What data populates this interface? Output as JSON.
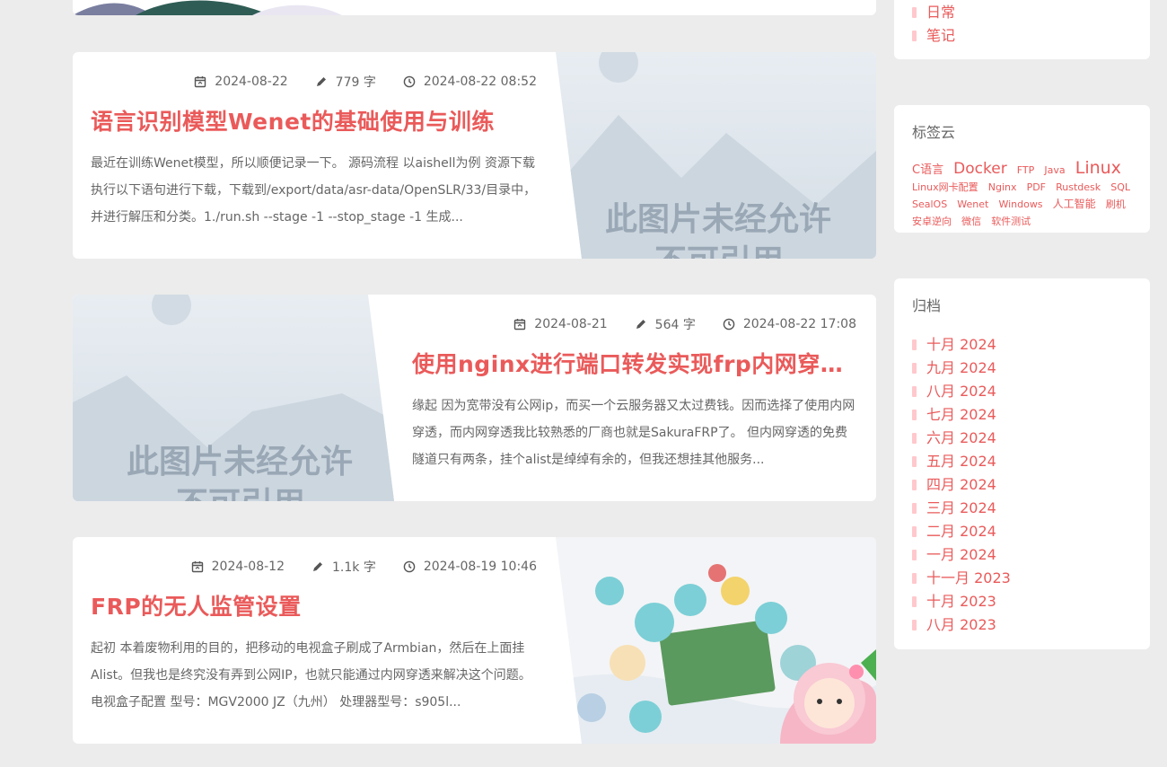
{
  "posts": [
    {
      "date": "2024-08-22",
      "words": "779 字",
      "updated": "2024-08-22 08:52",
      "title": "语言识别模型Wenet的基础使用与训练",
      "excerpt": "最近在训练Wenet模型，所以顺便记录一下。 源码流程 以aishell为例 资源下载 执行以下语句进行下载，下载到/export/data/asr-data/OpenSLR/33/目录中，并进行解压和分类。1./run.sh --stage -1 --stop_stage -1 生成...",
      "thumb_text": "此图片未经允许不可引用"
    },
    {
      "date": "2024-08-21",
      "words": "564 字",
      "updated": "2024-08-22 17:08",
      "title": "使用nginx进行端口转发实现frp内网穿透...",
      "excerpt": "缘起 因为宽带没有公网ip，而买一个云服务器又太过费钱。因而选择了使用内网穿透，而内网穿透我比较熟悉的厂商也就是SakuraFRP了。 但内网穿透的免费隧道只有两条，挂个alist是绰绰有余的，但我还想挂其他服务...",
      "thumb_text": "此图片未经允许不可引用"
    },
    {
      "date": "2024-08-12",
      "words": "1.1k 字",
      "updated": "2024-08-19 10:46",
      "title": "FRP的无人监管设置",
      "excerpt": "起初 本着废物利用的目的，把移动的电视盒子刷成了Armbian，然后在上面挂Alist。但我也是终究没有弄到公网IP，也就只能通过内网穿透来解决这个问题。 电视盒子配置 型号：MGV2000 JZ（九州） 处理器型号：s905l..."
    }
  ],
  "categories": [
    "日常",
    "笔记"
  ],
  "tag_cloud": {
    "title": "标签云",
    "tags": [
      {
        "label": "C语言",
        "size": 13
      },
      {
        "label": "Docker",
        "size": 17
      },
      {
        "label": "FTP",
        "size": 11
      },
      {
        "label": "Java",
        "size": 11
      },
      {
        "label": "Linux",
        "size": 19
      },
      {
        "label": "Linux网卡配置",
        "size": 11
      },
      {
        "label": "Nginx",
        "size": 11
      },
      {
        "label": "PDF",
        "size": 11
      },
      {
        "label": "Rustdesk",
        "size": 11
      },
      {
        "label": "SQL",
        "size": 11
      },
      {
        "label": "SealOS",
        "size": 11
      },
      {
        "label": "Wenet",
        "size": 11
      },
      {
        "label": "Windows",
        "size": 11
      },
      {
        "label": "人工智能",
        "size": 12
      },
      {
        "label": "刷机",
        "size": 11
      },
      {
        "label": "安卓逆向",
        "size": 11
      },
      {
        "label": "微信",
        "size": 11
      },
      {
        "label": "软件测试",
        "size": 11
      }
    ]
  },
  "archive": {
    "title": "归档",
    "months": [
      "十月 2024",
      "九月 2024",
      "八月 2024",
      "七月 2024",
      "六月 2024",
      "五月 2024",
      "四月 2024",
      "三月 2024",
      "二月 2024",
      "一月 2024",
      "十一月 2023",
      "十月 2023",
      "八月 2023"
    ]
  },
  "colors": {
    "accent": "#ea5a5a",
    "bullet": "#ffc8cc",
    "background": "#ececec"
  }
}
